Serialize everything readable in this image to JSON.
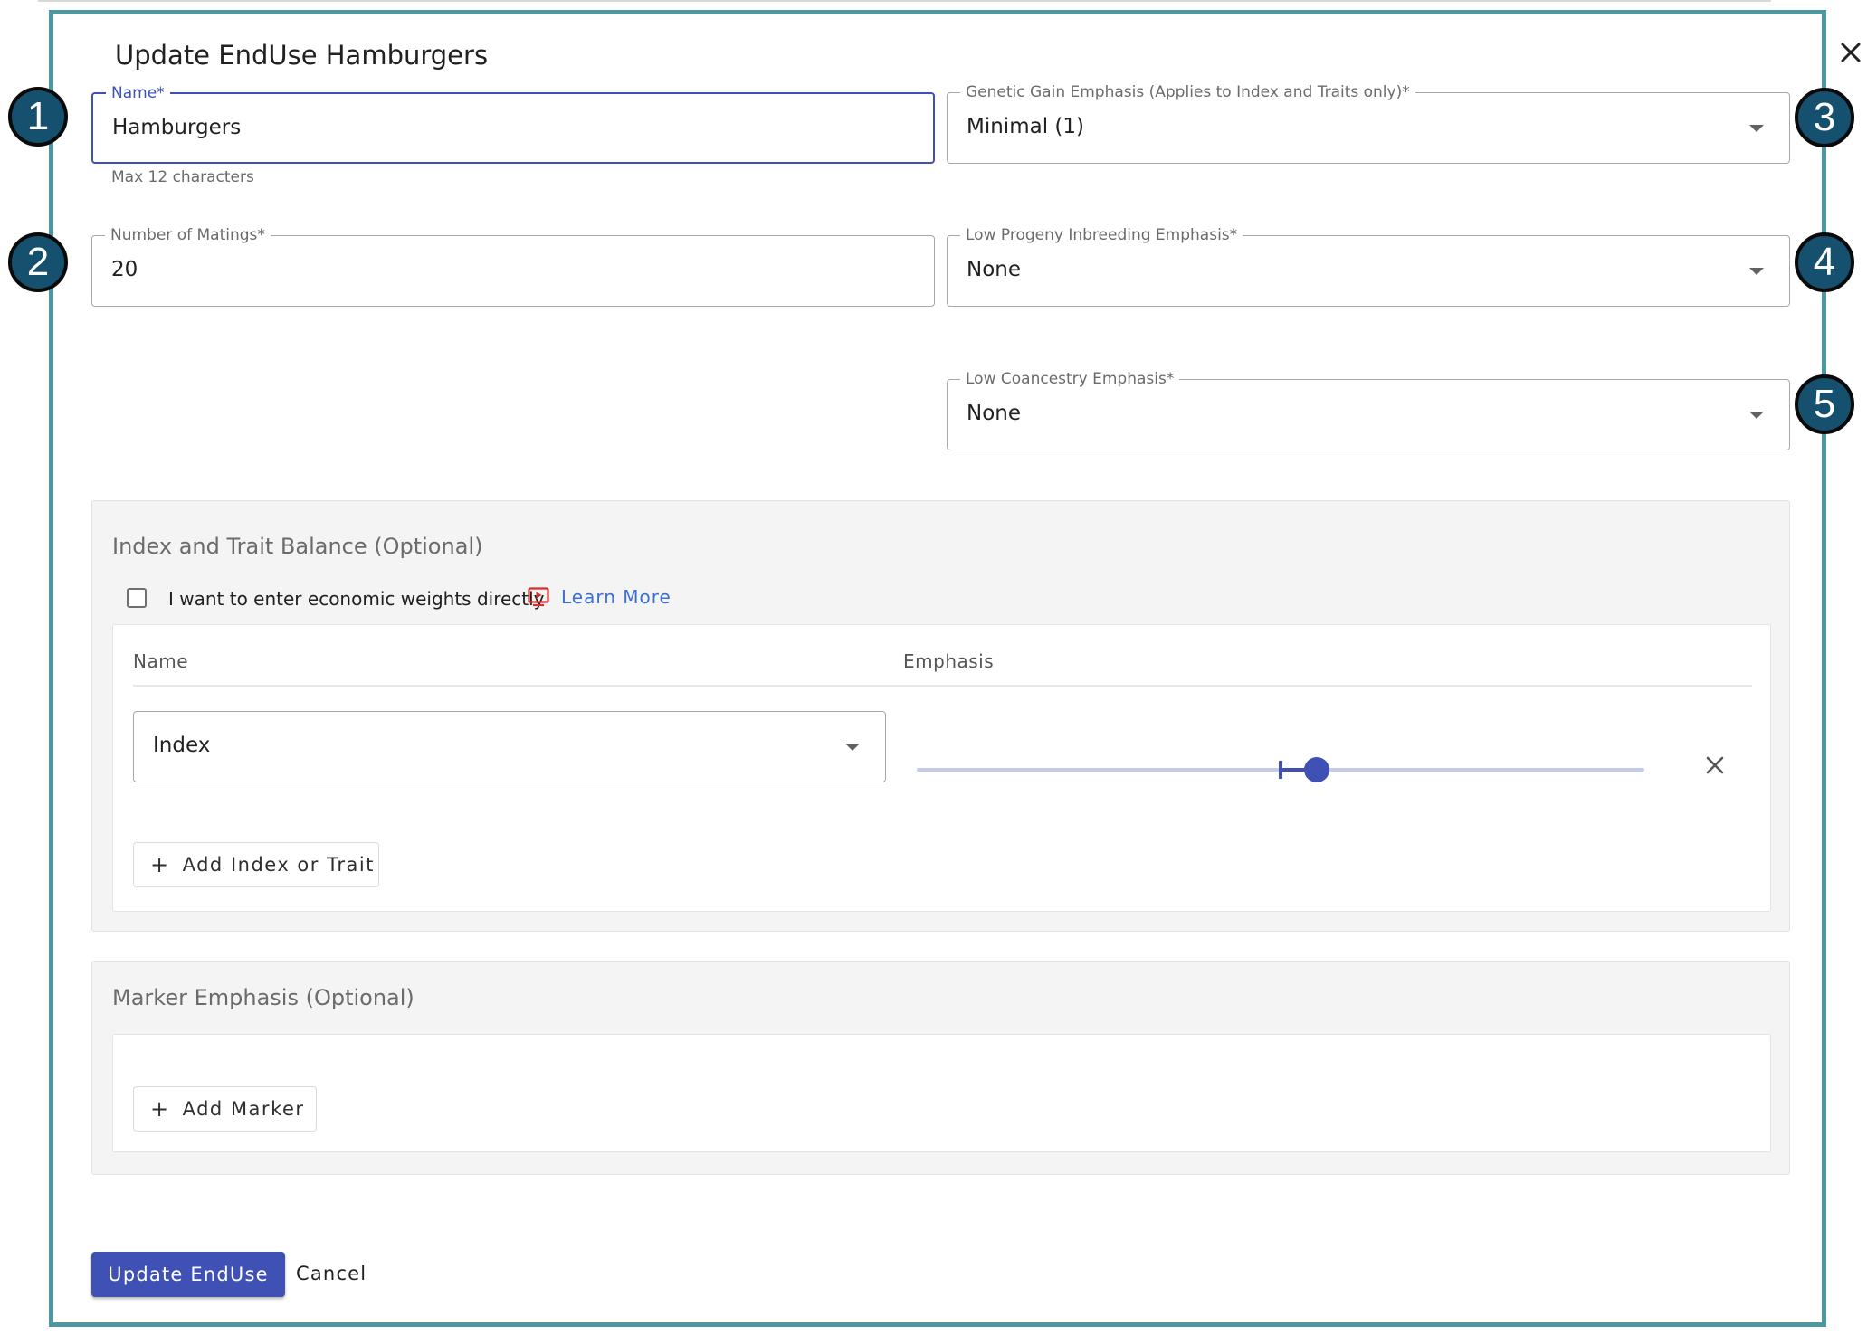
{
  "dialog": {
    "title": "Update EndUse Hamburgers",
    "close_icon": "close-icon"
  },
  "form": {
    "name": {
      "label": "Name*",
      "value": "Hamburgers",
      "helper": "Max 12 characters"
    },
    "matings": {
      "label": "Number of Matings*",
      "value": "20"
    },
    "genetic_gain": {
      "label": "Genetic Gain Emphasis (Applies to Index and Traits only)*",
      "value": "Minimal (1)"
    },
    "inbreeding": {
      "label": "Low Progeny Inbreeding Emphasis*",
      "value": "None"
    },
    "coancestry": {
      "label": "Low Coancestry Emphasis*",
      "value": "None"
    }
  },
  "badges": [
    "1",
    "2",
    "3",
    "4",
    "5"
  ],
  "index_section": {
    "title": "Index and Trait Balance (Optional)",
    "checkbox_label": "I want to enter economic weights directly",
    "checkbox_checked": false,
    "learn_more": "Learn More",
    "columns": [
      "Name",
      "Emphasis"
    ],
    "rows": [
      {
        "name": "Index",
        "emphasis_fraction": 0.55
      }
    ],
    "add_button": "Add Index or Trait"
  },
  "marker_section": {
    "title": "Marker Emphasis (Optional)",
    "add_button": "Add Marker"
  },
  "actions": {
    "primary": "Update EndUse",
    "cancel": "Cancel"
  },
  "colors": {
    "accent": "#3f51b5",
    "frame": "#4b98a0",
    "badge": "#15506f",
    "link": "#3d6ed1",
    "video_icon": "#d32f2f"
  }
}
